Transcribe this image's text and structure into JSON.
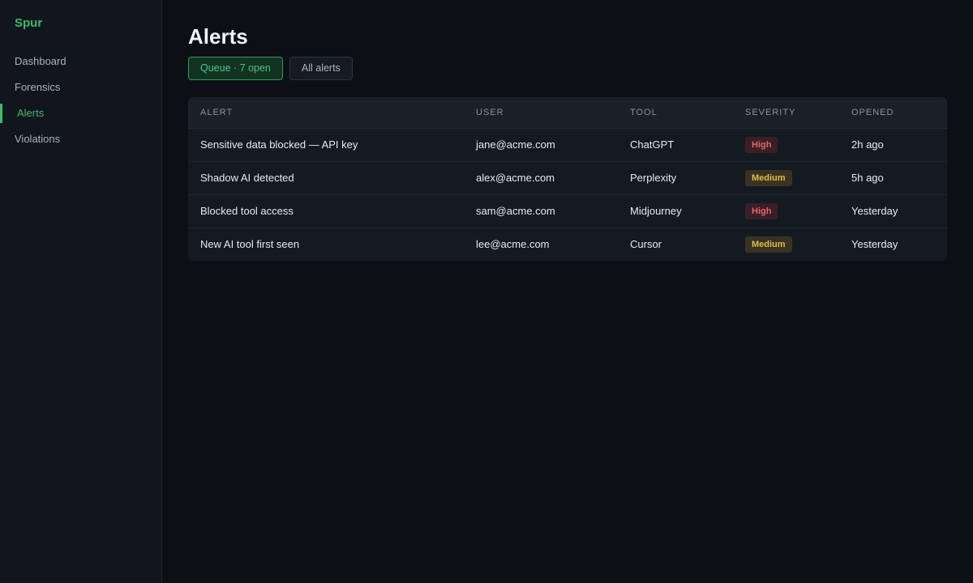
{
  "app": {
    "brand": "Spur"
  },
  "sidebar": {
    "items": [
      {
        "label": "Dashboard",
        "active": false
      },
      {
        "label": "Forensics",
        "active": false
      },
      {
        "label": "Alerts",
        "active": true
      },
      {
        "label": "Violations",
        "active": false
      }
    ]
  },
  "page": {
    "title": "Alerts"
  },
  "tabs": [
    {
      "label": "Queue · 7 open",
      "active": true
    },
    {
      "label": "All alerts",
      "active": false
    }
  ],
  "table": {
    "headers": [
      "ALERT",
      "USER",
      "TOOL",
      "SEVERITY",
      "OPENED"
    ],
    "rows": [
      {
        "alert": "Sensitive data blocked — API key",
        "user": "jane@acme.com",
        "tool": "ChatGPT",
        "severity": "High",
        "opened": "2h ago"
      },
      {
        "alert": "Shadow AI detected",
        "user": "alex@acme.com",
        "tool": "Perplexity",
        "severity": "Medium",
        "opened": "5h ago"
      },
      {
        "alert": "Blocked tool access",
        "user": "sam@acme.com",
        "tool": "Midjourney",
        "severity": "High",
        "opened": "Yesterday"
      },
      {
        "alert": "New AI tool first seen",
        "user": "lee@acme.com",
        "tool": "Cursor",
        "severity": "Medium",
        "opened": "Yesterday"
      }
    ]
  },
  "colors": {
    "accent": "#3fb968",
    "severity_high": "#e2656c",
    "severity_medium": "#e0b94a"
  }
}
